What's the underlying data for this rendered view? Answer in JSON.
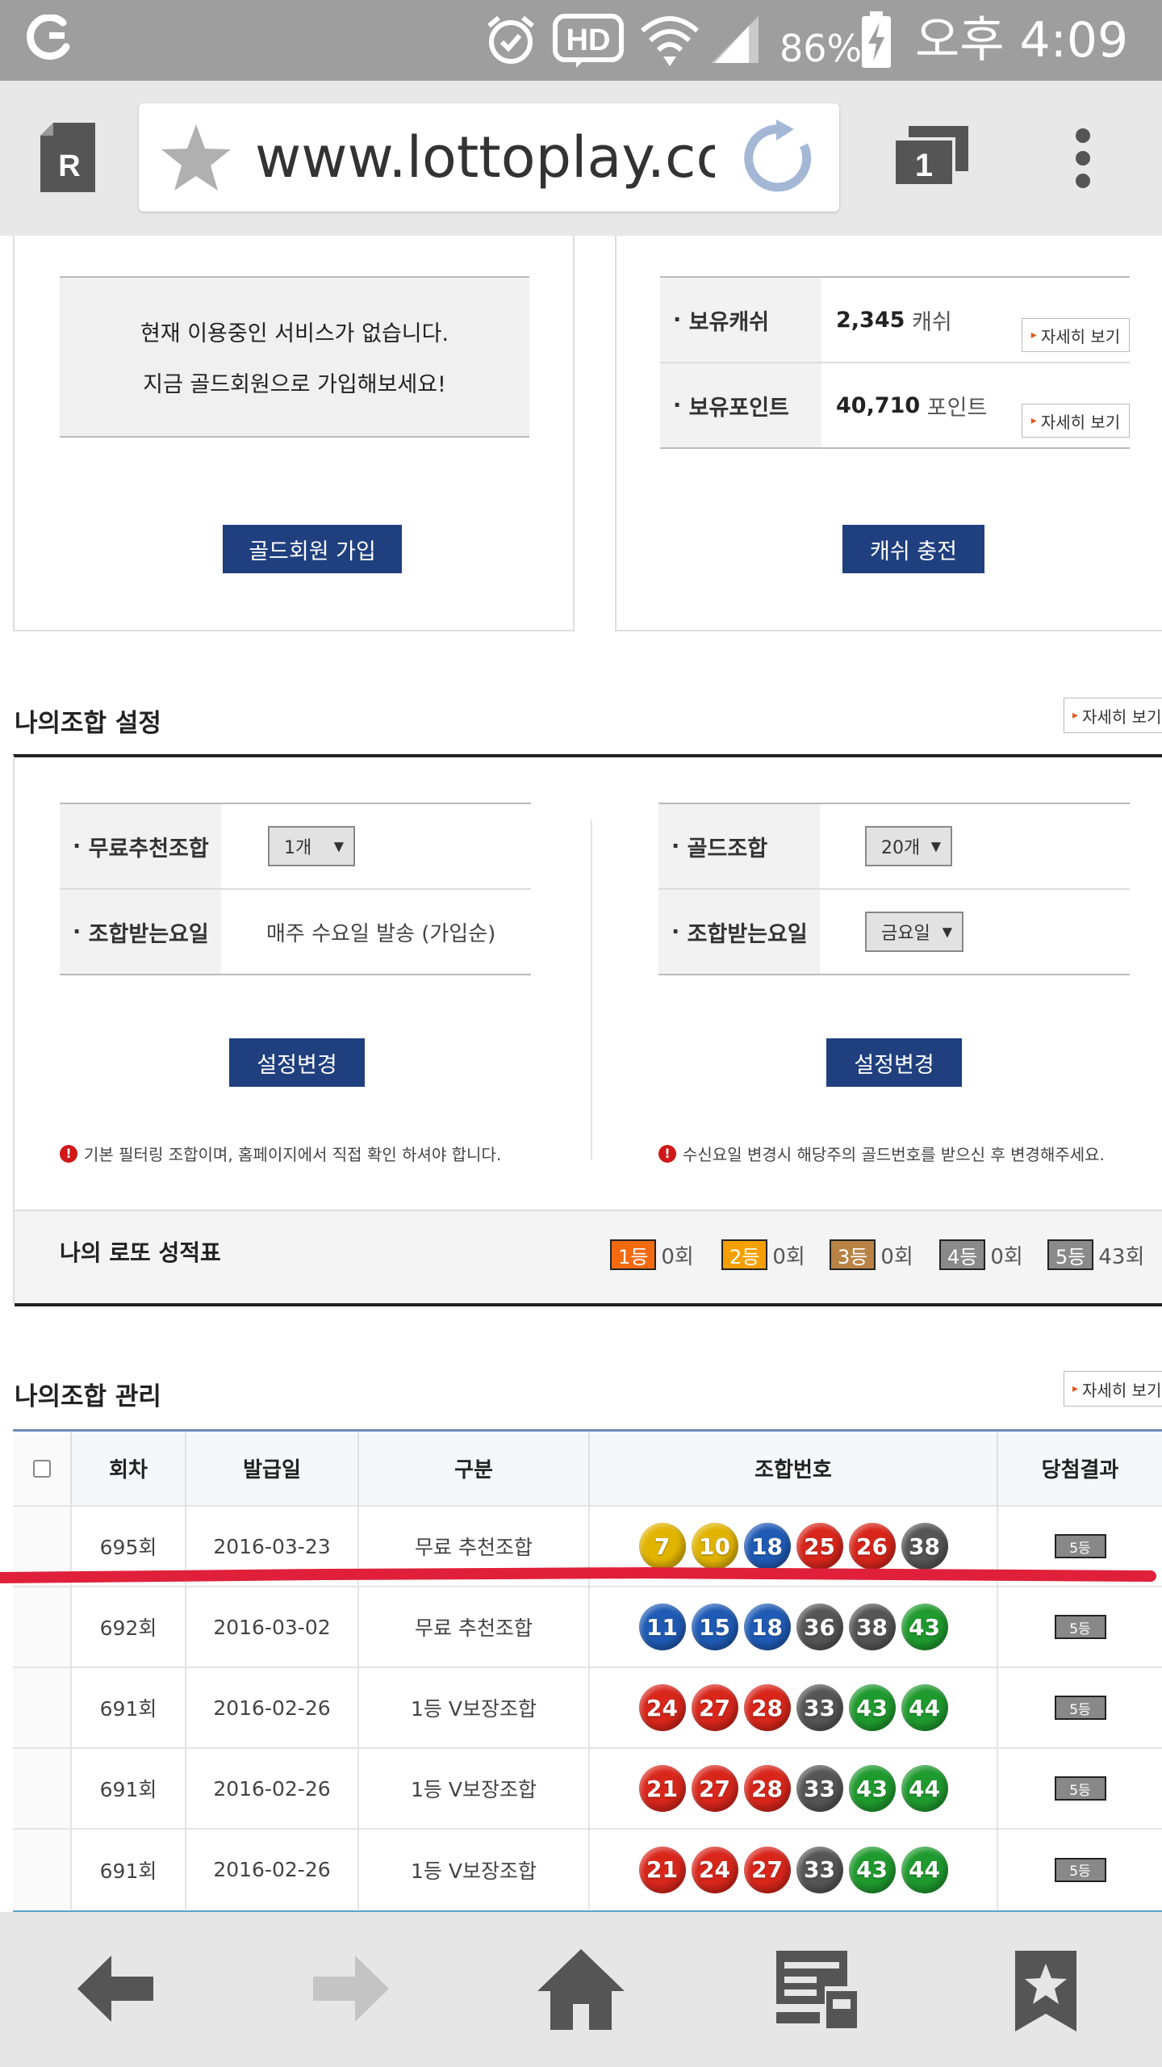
{
  "status_bar": {
    "battery": "86%",
    "time": "오후 4:09",
    "icons": [
      "carrier-icon",
      "alarm-icon",
      "hd-icon",
      "wifi-icon",
      "signal-icon",
      "battery-charging-icon"
    ]
  },
  "browser": {
    "url": "www.lottoplay.co.",
    "tab_count": "1",
    "icons": [
      "reader-icon",
      "star-icon",
      "reload-icon",
      "tabs-icon",
      "menu-icon"
    ]
  },
  "service_panel": {
    "message_line1": "현재 이용중인 서비스가 없습니다.",
    "message_line2": "지금 골드회원으로 가입해보세요!",
    "join_button": "골드회원 가입"
  },
  "wallet_panel": {
    "cash_label": "보유캐쉬",
    "cash_value": "2,345",
    "cash_unit": "캐쉬",
    "point_label": "보유포인트",
    "point_value": "40,710",
    "point_unit": "포인트",
    "detail_button": "자세히 보기",
    "charge_button": "캐쉬 충전"
  },
  "combo_settings": {
    "title": "나의조합 설정",
    "detail_button": "자세히 보기",
    "left": {
      "free_label": "무료추천조합",
      "free_select": "1개",
      "day_label": "조합받는요일",
      "day_value": "매주 수요일 발송 (가입순)",
      "change_button": "설정변경",
      "note": "기본 필터링 조합이며, 홈페이지에서 직접 확인 하셔야 합니다."
    },
    "right": {
      "gold_label": "골드조합",
      "gold_select": "20개",
      "day_label": "조합받는요일",
      "day_select": "금요일",
      "change_button": "설정변경",
      "note": "수신요일 변경시 해당주의 골드번호를 받으신 후 변경해주세요."
    }
  },
  "scorecard": {
    "title": "나의 로또 성적표",
    "ranks": [
      {
        "label": "1등",
        "count": "0회",
        "color": "#f36a10"
      },
      {
        "label": "2등",
        "count": "0회",
        "color": "#f5a000"
      },
      {
        "label": "3등",
        "count": "0회",
        "color": "#b98346"
      },
      {
        "label": "4등",
        "count": "0회",
        "color": "#8a8a8a"
      },
      {
        "label": "5등",
        "count": "43회",
        "color": "#8a8a8a"
      }
    ]
  },
  "combo_management": {
    "title": "나의조합 관리",
    "detail_button": "자세히 보기",
    "headers": [
      "회차",
      "발급일",
      "구분",
      "조합번호",
      "당첨결과"
    ],
    "rows": [
      {
        "round": "695회",
        "date": "2016-03-23",
        "type": "무료 추천조합",
        "numbers": [
          "7",
          "10",
          "18",
          "25",
          "26",
          "38"
        ],
        "colors": [
          "#e2b400",
          "#e2b400",
          "#1f5bb5",
          "#d9261b",
          "#d9261b",
          "#555555"
        ],
        "result": "5등"
      },
      {
        "round": "692회",
        "date": "2016-03-02",
        "type": "무료 추천조합",
        "numbers": [
          "11",
          "15",
          "18",
          "36",
          "38",
          "43"
        ],
        "colors": [
          "#1f5bb5",
          "#1f5bb5",
          "#1f5bb5",
          "#555555",
          "#555555",
          "#1f9a2e"
        ],
        "result": "5등"
      },
      {
        "round": "691회",
        "date": "2016-02-26",
        "type": "1등 V보장조합",
        "numbers": [
          "24",
          "27",
          "28",
          "33",
          "43",
          "44"
        ],
        "colors": [
          "#d9261b",
          "#d9261b",
          "#d9261b",
          "#555555",
          "#1f9a2e",
          "#1f9a2e"
        ],
        "result": "5등"
      },
      {
        "round": "691회",
        "date": "2016-02-26",
        "type": "1등 V보장조합",
        "numbers": [
          "21",
          "27",
          "28",
          "33",
          "43",
          "44"
        ],
        "colors": [
          "#d9261b",
          "#d9261b",
          "#d9261b",
          "#555555",
          "#1f9a2e",
          "#1f9a2e"
        ],
        "result": "5등"
      },
      {
        "round": "691회",
        "date": "2016-02-26",
        "type": "1등 V보장조합",
        "numbers": [
          "21",
          "24",
          "27",
          "33",
          "43",
          "44"
        ],
        "colors": [
          "#d9261b",
          "#d9261b",
          "#d9261b",
          "#555555",
          "#1f9a2e",
          "#1f9a2e"
        ],
        "result": "5등"
      }
    ]
  },
  "bottom_nav": {
    "icons": [
      "back-arrow-icon",
      "forward-arrow-icon",
      "home-icon",
      "reading-list-icon",
      "bookmark-icon"
    ]
  }
}
